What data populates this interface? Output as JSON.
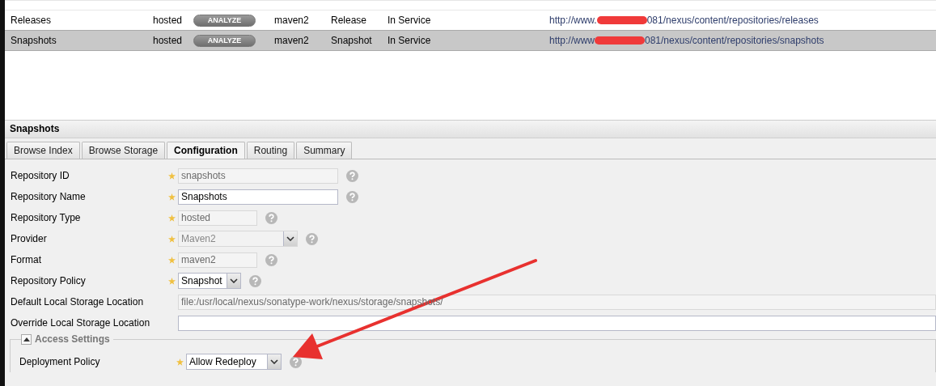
{
  "repositories": [
    {
      "name": "Releases",
      "type": "hosted",
      "action": "ANALYZE",
      "format": "maven2",
      "policy": "Release",
      "status": "In Service",
      "url_start": "http://www.",
      "url_end": "081/nexus/content/repositories/releases",
      "selected": false
    },
    {
      "name": "Snapshots",
      "type": "hosted",
      "action": "ANALYZE",
      "format": "maven2",
      "policy": "Snapshot",
      "status": "In Service",
      "url_start": "http://www",
      "url_end": "081/nexus/content/repositories/snapshots",
      "selected": true
    }
  ],
  "panel": {
    "title": "Snapshots",
    "tabs": [
      {
        "label": "Browse Index",
        "selected": false
      },
      {
        "label": "Browse Storage",
        "selected": false
      },
      {
        "label": "Configuration",
        "selected": true
      },
      {
        "label": "Routing",
        "selected": false
      },
      {
        "label": "Summary",
        "selected": false
      }
    ],
    "fields": [
      {
        "label": "Repository ID",
        "required": true,
        "kind": "text",
        "value": "snapshots",
        "disabled": true,
        "help": true
      },
      {
        "label": "Repository Name",
        "required": true,
        "kind": "text",
        "value": "Snapshots",
        "disabled": false,
        "help": true
      },
      {
        "label": "Repository Type",
        "required": true,
        "kind": "short-text",
        "value": "hosted",
        "disabled": true,
        "help": true
      },
      {
        "label": "Provider",
        "required": true,
        "kind": "wide-combo",
        "value": "Maven2",
        "disabled": true,
        "help": true
      },
      {
        "label": "Format",
        "required": true,
        "kind": "short-text",
        "value": "maven2",
        "disabled": true,
        "help": true
      },
      {
        "label": "Repository Policy",
        "required": true,
        "kind": "short-combo",
        "value": "Snapshot",
        "disabled": false,
        "help": true
      },
      {
        "label": "Default Local Storage Location",
        "kind": "long-text",
        "value": "file:/usr/local/nexus/sonatype-work/nexus/storage/snapshots/",
        "disabled": true
      },
      {
        "label": "Override Local Storage Location",
        "kind": "long-text",
        "disabled": false
      }
    ],
    "access_settings": {
      "title": "Access Settings",
      "expanded": true,
      "fields": [
        {
          "label": "Deployment Policy",
          "required": true,
          "kind": "combo",
          "value": "Allow Redeploy",
          "disabled": false,
          "help": true
        }
      ]
    }
  }
}
